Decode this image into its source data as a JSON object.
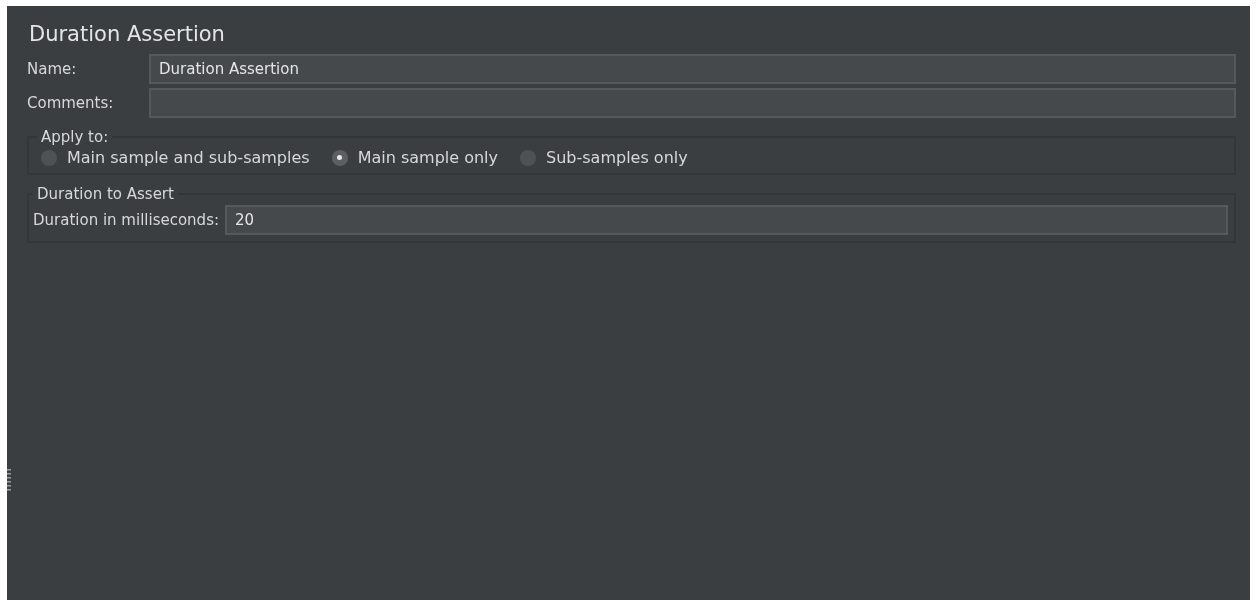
{
  "title": "Duration Assertion",
  "name_field": {
    "label": "Name:",
    "value": "Duration Assertion"
  },
  "comments_field": {
    "label": "Comments:"
  },
  "apply_to": {
    "legend": "Apply to:",
    "options": [
      {
        "label": "Main sample and sub-samples",
        "selected": false
      },
      {
        "label": "Main sample only",
        "selected": true
      },
      {
        "label": "Sub-samples only",
        "selected": false
      }
    ]
  },
  "duration_group": {
    "legend": "Duration to Assert",
    "label": "Duration in milliseconds:",
    "value": "20"
  }
}
